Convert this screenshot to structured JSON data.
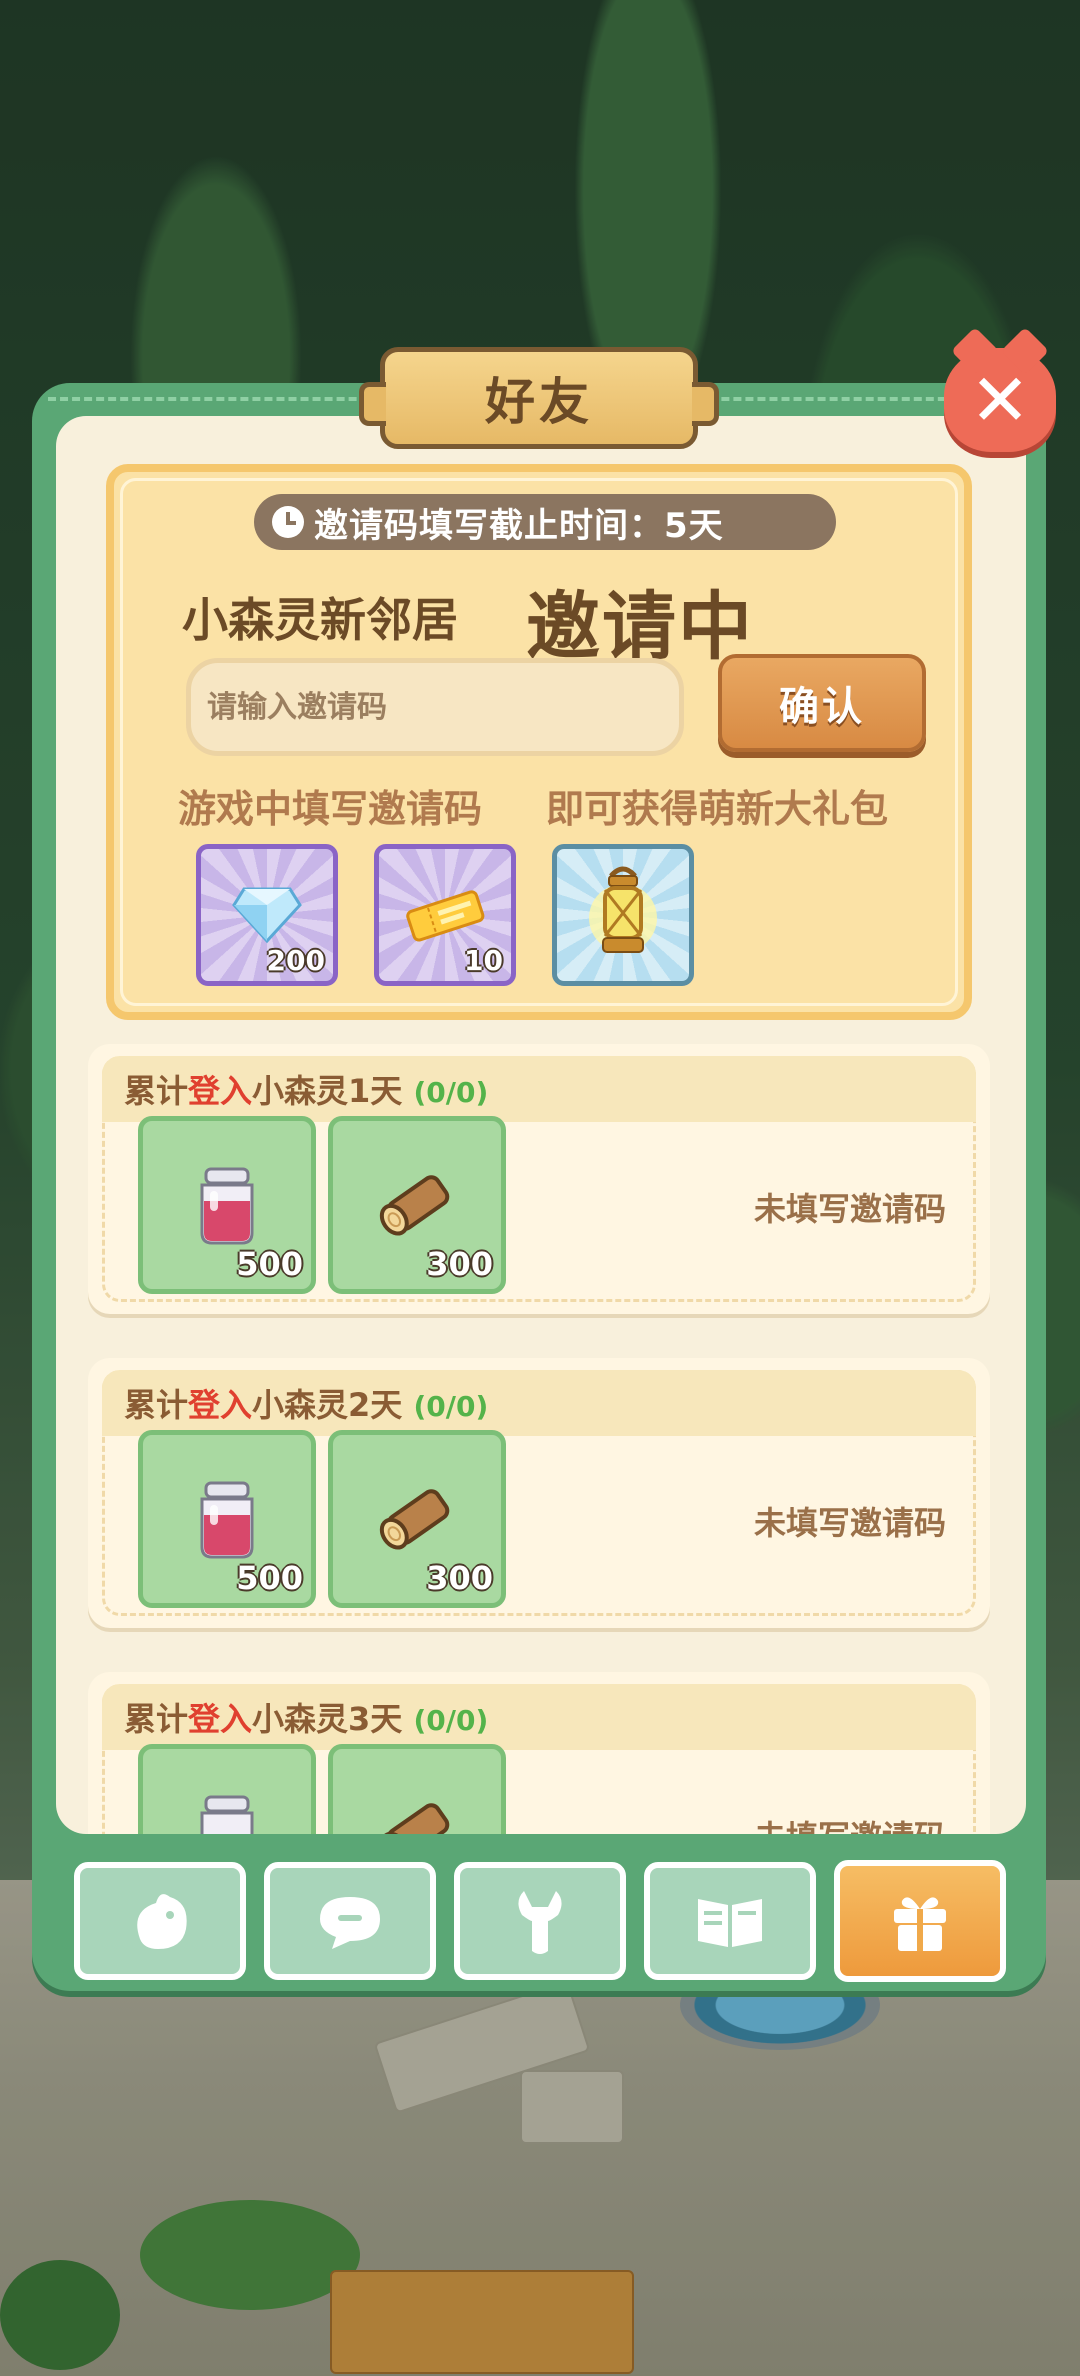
{
  "dialog": {
    "title": "好友"
  },
  "invite": {
    "deadline": "邀请码填写截止时间：5天",
    "headline_left": "小森灵新邻居",
    "headline_right": "邀请中",
    "input_placeholder": "请输入邀请码",
    "confirm_label": "确认",
    "hint_left": "游戏中填写邀请码",
    "hint_right": "即可获得萌新大礼包",
    "gifts": [
      {
        "icon": "diamond-icon",
        "qty": "200"
      },
      {
        "icon": "ticket-icon",
        "qty": "10"
      },
      {
        "icon": "lantern-icon",
        "qty": ""
      }
    ]
  },
  "rows": [
    {
      "prefix": "累计",
      "highlight": "登入",
      "suffix": "小森灵1天",
      "progress": "(0/0)",
      "rewards": [
        {
          "icon": "jam-jar-icon",
          "qty": "500"
        },
        {
          "icon": "wood-log-icon",
          "qty": "300"
        }
      ],
      "status": "未填写邀请码"
    },
    {
      "prefix": "累计",
      "highlight": "登入",
      "suffix": "小森灵2天",
      "progress": "(0/0)",
      "rewards": [
        {
          "icon": "jam-jar-icon",
          "qty": "500"
        },
        {
          "icon": "wood-log-icon",
          "qty": "300"
        }
      ],
      "status": "未填写邀请码"
    },
    {
      "prefix": "累计",
      "highlight": "登入",
      "suffix": "小森灵3天",
      "progress": "(0/0)",
      "rewards": [
        {
          "icon": "jam-jar-icon",
          "qty": ""
        },
        {
          "icon": "wood-log-icon",
          "qty": ""
        }
      ],
      "status": "未填写邀请码"
    }
  ],
  "tabs": [
    {
      "icon": "chick-icon",
      "active": false
    },
    {
      "icon": "chat-icon",
      "active": false
    },
    {
      "icon": "wrench-icon",
      "active": false
    },
    {
      "icon": "book-icon",
      "active": false
    },
    {
      "icon": "gift-icon",
      "active": true
    }
  ],
  "colors": {
    "panel": "#5aa775",
    "accent": "#ee9a3c",
    "highlight": "#e0402f",
    "progress": "#54b34a"
  }
}
